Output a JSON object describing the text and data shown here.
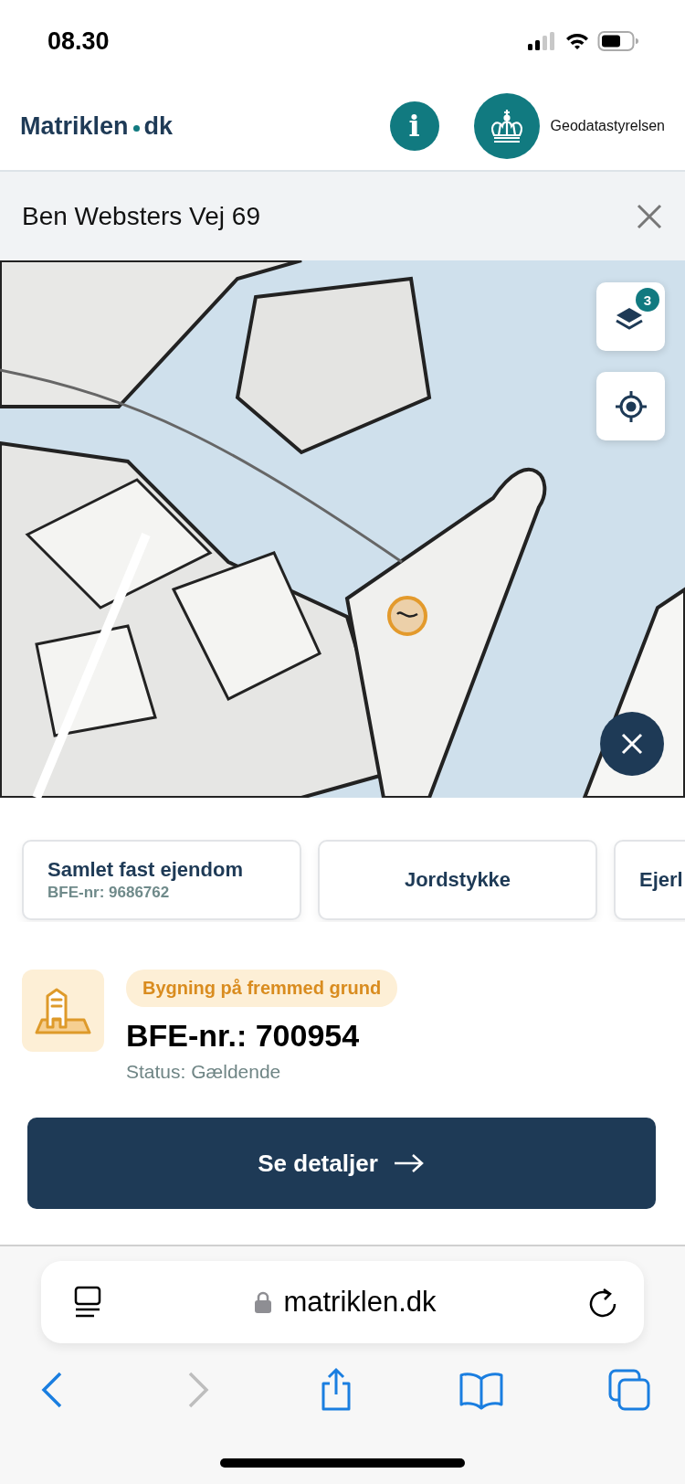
{
  "status_bar": {
    "time": "08.30"
  },
  "header": {
    "logo": {
      "part_1": "Matriklen",
      "part_2": "dk"
    },
    "info_button": "i",
    "agency": "Geodatastyrelsen"
  },
  "address_bar": {
    "title": "Ben Websters Vej 69"
  },
  "map": {
    "kind": "picture",
    "layers_badge": "3"
  },
  "cards": [
    {
      "title": "Samlet fast ejendom",
      "subtitle": "BFE-nr: 9686762"
    },
    {
      "title": "Jordstykke"
    },
    {
      "title": "Ejerl"
    }
  ],
  "property": {
    "tag": "Bygning på fremmed grund",
    "title": "BFE-nr.: 700954",
    "status": "Status: Gældende",
    "button": "Se detaljer"
  },
  "browser": {
    "url": "matriklen.dk",
    "forward_disabled": true
  }
}
